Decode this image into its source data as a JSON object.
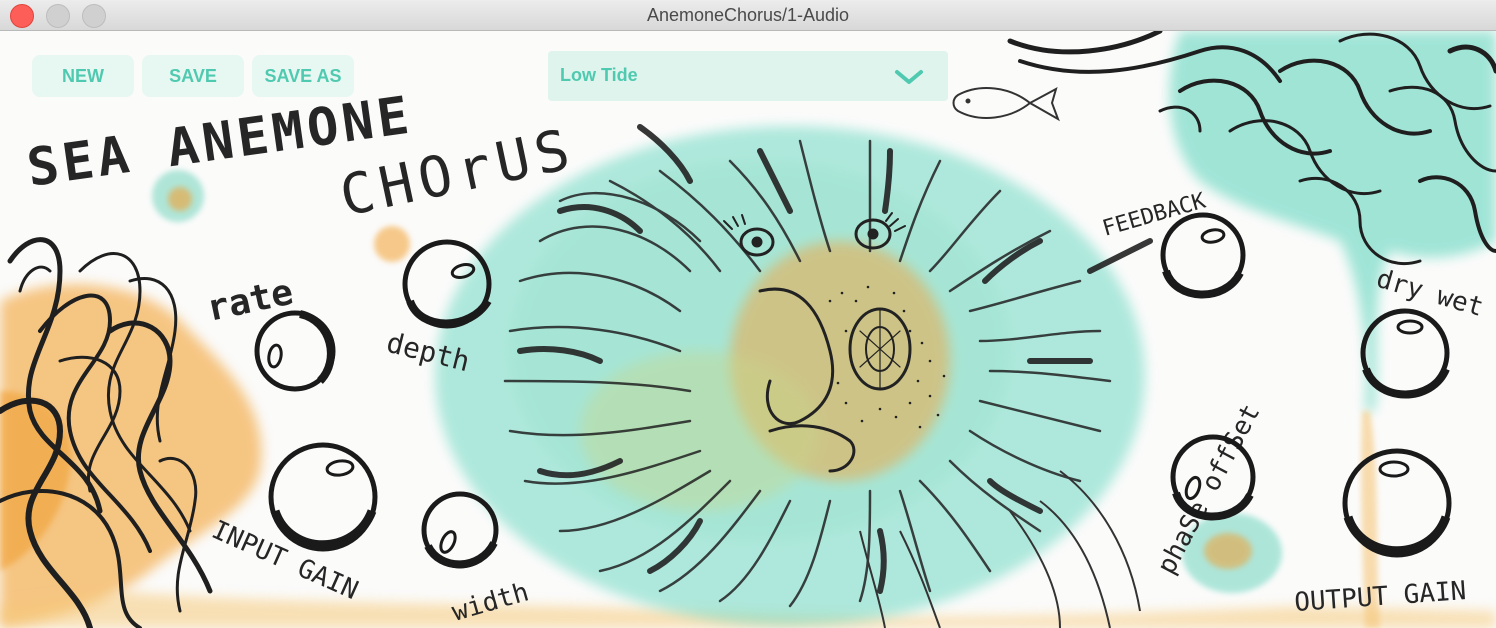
{
  "window": {
    "title": "AnemoneChorus/1-Audio"
  },
  "toolbar": {
    "new_label": "NEW",
    "save_label": "SAVE",
    "save_as_label": "SAVE AS"
  },
  "preset": {
    "selected": "Low Tide"
  },
  "titles": {
    "line1": "SEA ANEMONE",
    "line2": "CHOrUS"
  },
  "knobs": {
    "rate": "rate",
    "depth": "depth",
    "input_gain": "INPUT GAIN",
    "width": "width",
    "feedback": "FEEDBACK",
    "phase_offset": "phaSe offSet",
    "dry_wet": "dry wet",
    "output_gain": "OUTPUT GAIN"
  },
  "colors": {
    "accent": "#4fcab0",
    "teal_wash": "#5fd6c0",
    "orange_wash": "#f2a23c",
    "ink": "#262626"
  }
}
